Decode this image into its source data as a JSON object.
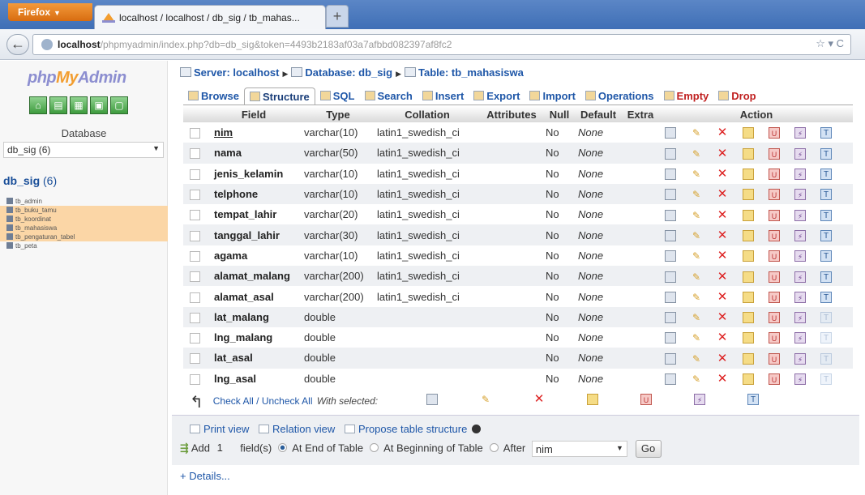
{
  "browser": {
    "menu_label": "Firefox",
    "tab_title": "localhost / localhost / db_sig / tb_mahas...",
    "newtab_label": "+",
    "url_host": "localhost",
    "url_rest": "/phpmyadmin/index.php?db=db_sig&token=4493b2183af03a7afbbd082397af8fc2"
  },
  "sidebar": {
    "logo_php": "php",
    "logo_my": "My",
    "logo_admin": "Admin",
    "db_label": "Database",
    "db_select": "db_sig (6)",
    "db_name": "db_sig",
    "db_count": "(6)",
    "tables": [
      "tb_admin",
      "tb_buku_tamu",
      "tb_koordinat",
      "tb_mahasiswa",
      "tb_pengaturan_tabel",
      "tb_peta"
    ]
  },
  "breadcrumb": {
    "server": "Server: localhost",
    "database": "Database: db_sig",
    "table": "Table: tb_mahasiswa"
  },
  "tabs": {
    "browse": "Browse",
    "structure": "Structure",
    "sql": "SQL",
    "search": "Search",
    "insert": "Insert",
    "export": "Export",
    "import": "Import",
    "operations": "Operations",
    "empty": "Empty",
    "drop": "Drop"
  },
  "table": {
    "headers": {
      "field": "Field",
      "type": "Type",
      "collation": "Collation",
      "attributes": "Attributes",
      "null": "Null",
      "default": "Default",
      "extra": "Extra",
      "action": "Action"
    },
    "rows": [
      {
        "field": "nim",
        "type": "varchar(10)",
        "collation": "latin1_swedish_ci",
        "null": "No",
        "default": "None"
      },
      {
        "field": "nama",
        "type": "varchar(50)",
        "collation": "latin1_swedish_ci",
        "null": "No",
        "default": "None"
      },
      {
        "field": "jenis_kelamin",
        "type": "varchar(10)",
        "collation": "latin1_swedish_ci",
        "null": "No",
        "default": "None"
      },
      {
        "field": "telphone",
        "type": "varchar(10)",
        "collation": "latin1_swedish_ci",
        "null": "No",
        "default": "None"
      },
      {
        "field": "tempat_lahir",
        "type": "varchar(20)",
        "collation": "latin1_swedish_ci",
        "null": "No",
        "default": "None"
      },
      {
        "field": "tanggal_lahir",
        "type": "varchar(30)",
        "collation": "latin1_swedish_ci",
        "null": "No",
        "default": "None"
      },
      {
        "field": "agama",
        "type": "varchar(10)",
        "collation": "latin1_swedish_ci",
        "null": "No",
        "default": "None"
      },
      {
        "field": "alamat_malang",
        "type": "varchar(200)",
        "collation": "latin1_swedish_ci",
        "null": "No",
        "default": "None"
      },
      {
        "field": "alamat_asal",
        "type": "varchar(200)",
        "collation": "latin1_swedish_ci",
        "null": "No",
        "default": "None"
      },
      {
        "field": "lat_malang",
        "type": "double",
        "collation": "",
        "null": "No",
        "default": "None"
      },
      {
        "field": "lng_malang",
        "type": "double",
        "collation": "",
        "null": "No",
        "default": "None"
      },
      {
        "field": "lat_asal",
        "type": "double",
        "collation": "",
        "null": "No",
        "default": "None"
      },
      {
        "field": "lng_asal",
        "type": "double",
        "collation": "",
        "null": "No",
        "default": "None"
      }
    ]
  },
  "checkall": {
    "check_all": "Check All",
    "separator": " / ",
    "uncheck_all": "Uncheck All",
    "with_selected": "With selected:"
  },
  "bottom": {
    "print_view": "Print view",
    "relation_view": "Relation view",
    "propose": "Propose table structure",
    "add_label": "Add",
    "add_count": "1",
    "fields_label": "field(s)",
    "at_end": "At End of Table",
    "at_beginning": "At Beginning of Table",
    "after": "After",
    "after_value": "nim",
    "go": "Go"
  },
  "details": "+ Details..."
}
